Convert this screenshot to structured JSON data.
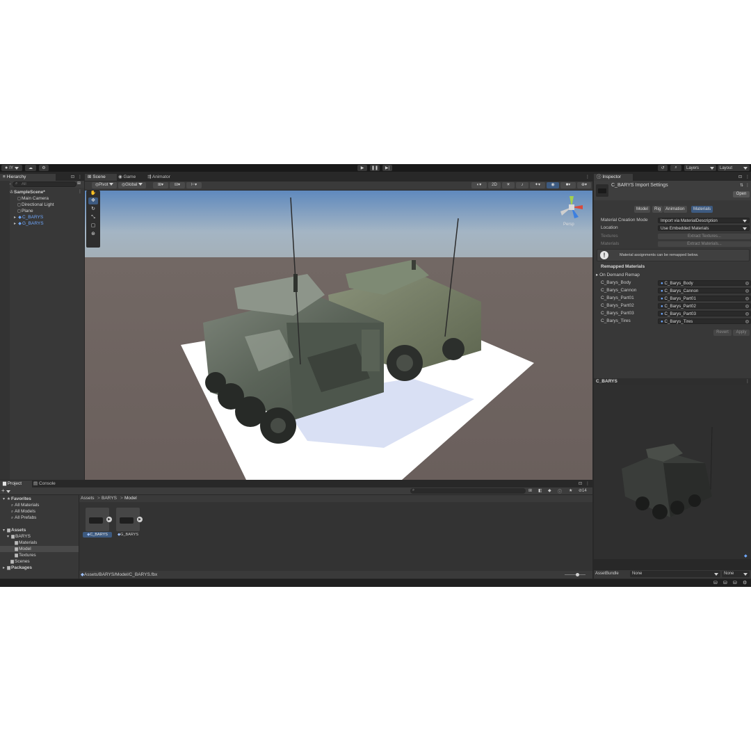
{
  "toolbar": {
    "account_label": "IY",
    "layers_label": "Layers",
    "layout_label": "Layout"
  },
  "hierarchy": {
    "tab_label": "Hierarchy",
    "search_placeholder": "All",
    "items": [
      {
        "label": "SampleScene*"
      },
      {
        "label": "Main Camera"
      },
      {
        "label": "Directional Light"
      },
      {
        "label": "Plane"
      },
      {
        "label": "C_BARYS"
      },
      {
        "label": "G_BARYS"
      }
    ]
  },
  "scene": {
    "tabs": [
      "Scene",
      "Game",
      "Animator"
    ],
    "pivot_label": "Pivot",
    "global_label": "Global",
    "mode_2d": "2D",
    "persp_label": "Persp"
  },
  "inspector": {
    "tab_label": "Inspector",
    "title": "C_BARYS Import Settings",
    "open_label": "Open",
    "tabs": [
      "Model",
      "Rig",
      "Animation",
      "Materials"
    ],
    "material_creation_mode_label": "Material Creation Mode",
    "material_creation_mode_value": "Import via MaterialDescription",
    "location_label": "Location",
    "location_value": "Use Embedded Materials",
    "textures_label": "Textures",
    "extract_textures_label": "Extract Textures...",
    "materials_label": "Materials",
    "extract_materials_label": "Extract Materials...",
    "info_text": "Material assignments can be remapped below.",
    "remapped_header": "Remapped Materials",
    "on_demand_label": "On Demand Remap",
    "remap": [
      {
        "name": "C_Barys_Body",
        "value": "C_Barys_Body"
      },
      {
        "name": "C_Barys_Cannon",
        "value": "C_Barys_Cannon"
      },
      {
        "name": "C_Barys_Part01",
        "value": "C_Barys_Part01"
      },
      {
        "name": "C_Barys_Part02",
        "value": "C_Barys_Part02"
      },
      {
        "name": "C_Barys_Part03",
        "value": "C_Barys_Part03"
      },
      {
        "name": "C_Barys_Tires",
        "value": "C_Barys_Tires"
      }
    ],
    "revert_label": "Revert",
    "apply_label": "Apply",
    "preview_title": "C_BARYS",
    "assetbundle_label": "AssetBundle",
    "assetbundle_value": "None",
    "variant_value": "None"
  },
  "project": {
    "tabs": [
      "Project",
      "Console"
    ],
    "favorites_label": "Favorites",
    "favorites": [
      "All Materials",
      "All Models",
      "All Prefabs"
    ],
    "assets_label": "Assets",
    "barys_label": "BARYS",
    "barys_children": [
      "Materials",
      "Model",
      "Textures"
    ],
    "scenes_label": "Scenes",
    "packages_label": "Packages",
    "breadcrumb": [
      "Assets",
      "BARYS",
      "Model"
    ],
    "badge_count": "14",
    "assets": [
      {
        "label": "C_BARYS"
      },
      {
        "label": "G_BARYS"
      }
    ],
    "status_path": "Assets/BARYS/Model/C_BARYS.fbx"
  }
}
